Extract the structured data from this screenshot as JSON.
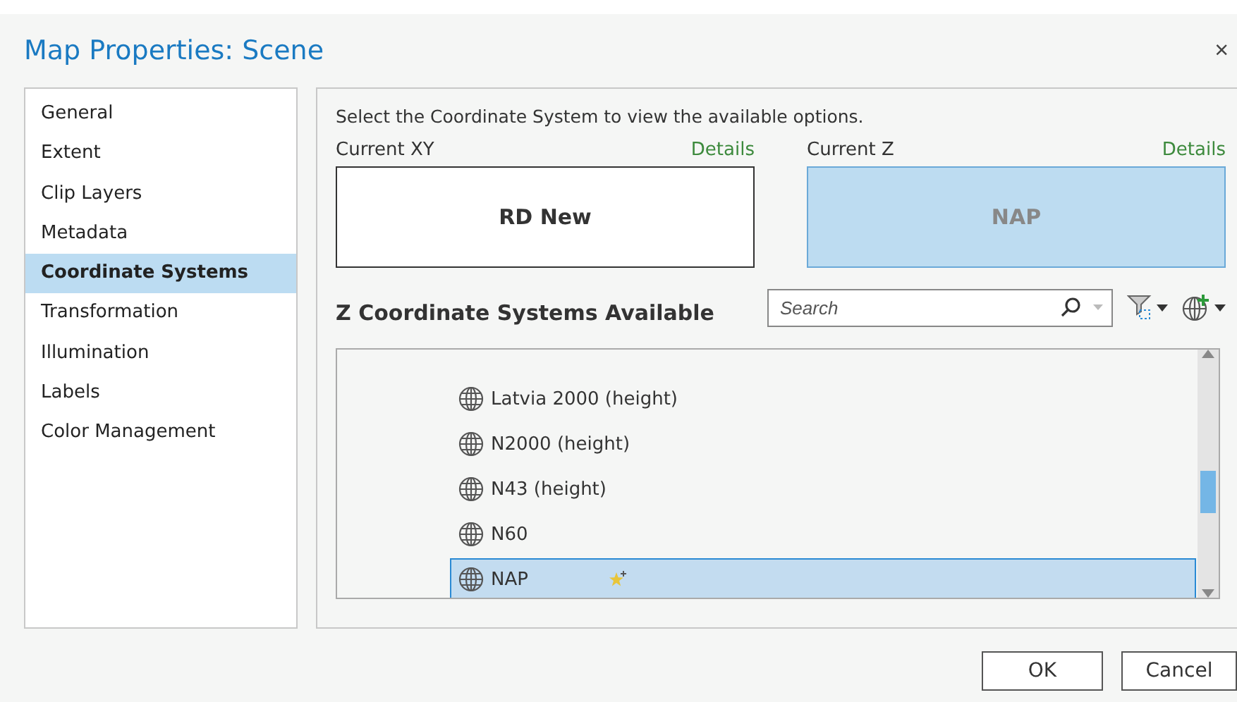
{
  "window": {
    "title": "Map Properties: Scene",
    "close": "×"
  },
  "sidebar": {
    "items": [
      {
        "label": "General",
        "selected": false
      },
      {
        "label": "Extent",
        "selected": false
      },
      {
        "label": "Clip Layers",
        "selected": false
      },
      {
        "label": "Metadata",
        "selected": false
      },
      {
        "label": "Coordinate Systems",
        "selected": true
      },
      {
        "label": "Transformation",
        "selected": false
      },
      {
        "label": "Illumination",
        "selected": false
      },
      {
        "label": "Labels",
        "selected": false
      },
      {
        "label": "Color Management",
        "selected": false
      }
    ]
  },
  "instruction": "Select the Coordinate System to view the available options.",
  "current": [
    {
      "label": "Current XY",
      "details": "Details",
      "value": "RD New",
      "selected": false
    },
    {
      "label": "Current Z",
      "details": "Details",
      "value": "NAP",
      "selected": true
    }
  ],
  "available": {
    "title": "Z Coordinate Systems Available",
    "search": {
      "placeholder": "Search"
    },
    "items": [
      {
        "label": "Latvia 2000 (height)",
        "selected": false,
        "favorite": false
      },
      {
        "label": "N2000 (height)",
        "selected": false,
        "favorite": false
      },
      {
        "label": "N43 (height)",
        "selected": false,
        "favorite": false
      },
      {
        "label": "N60",
        "selected": false,
        "favorite": false
      },
      {
        "label": "NAP",
        "selected": true,
        "favorite": true
      }
    ]
  },
  "buttons": [
    "OK",
    "Cancel"
  ]
}
